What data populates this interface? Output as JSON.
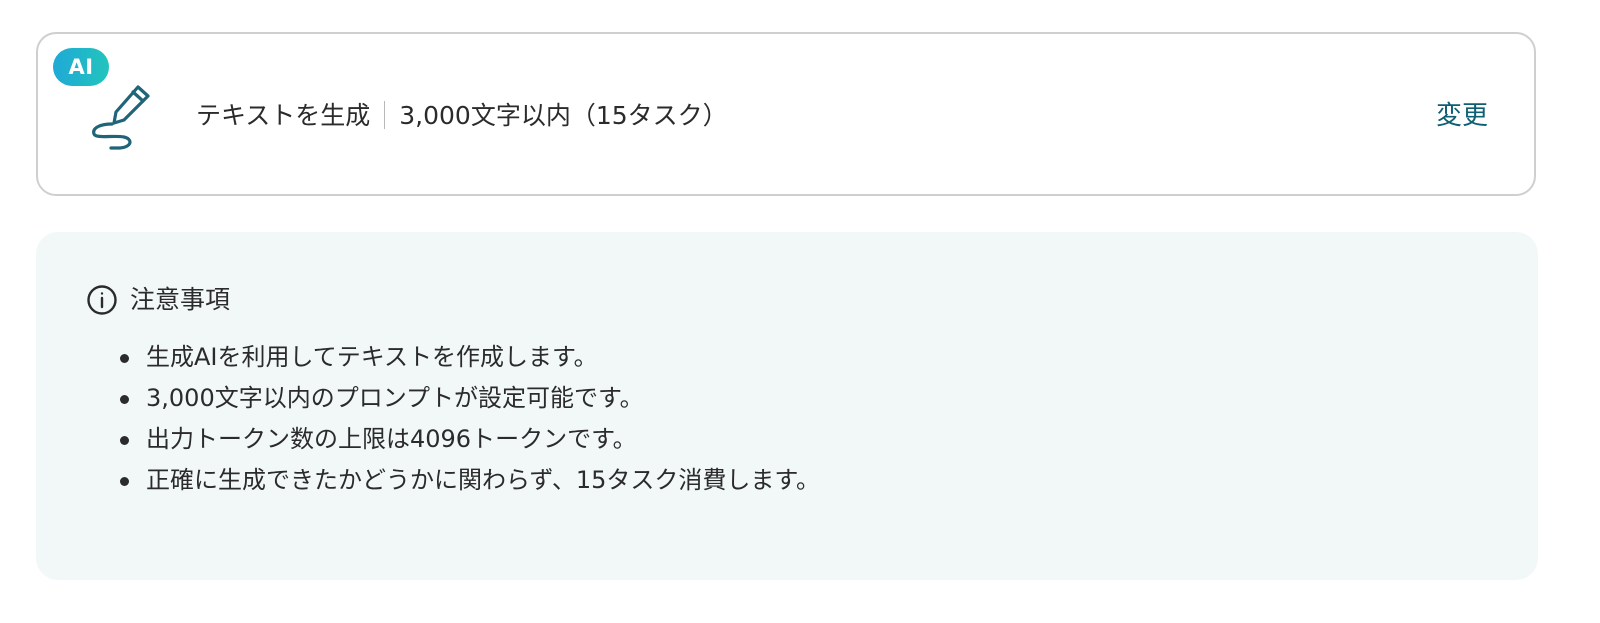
{
  "action": {
    "badge": "AI",
    "icon": "pen-signature-icon",
    "title": "テキストを生成",
    "detail": "3,000文字以内（15タスク）",
    "change_label": "変更"
  },
  "notes": {
    "icon": "info-icon",
    "title": "注意事項",
    "items": [
      "生成AIを利用してテキストを作成します。",
      "3,000文字以内のプロンプトが設定可能です。",
      "出力トークン数の上限は4096トークンです。",
      "正確に生成できたかどうかに関わらず、15タスク消費します。"
    ]
  },
  "colors": {
    "accent": "#0f5f73",
    "badge_gradient": [
      "#1fa9d6",
      "#22c4bd"
    ],
    "panel_bg": "#f2f8f8",
    "card_border": "#cfcfcf"
  }
}
